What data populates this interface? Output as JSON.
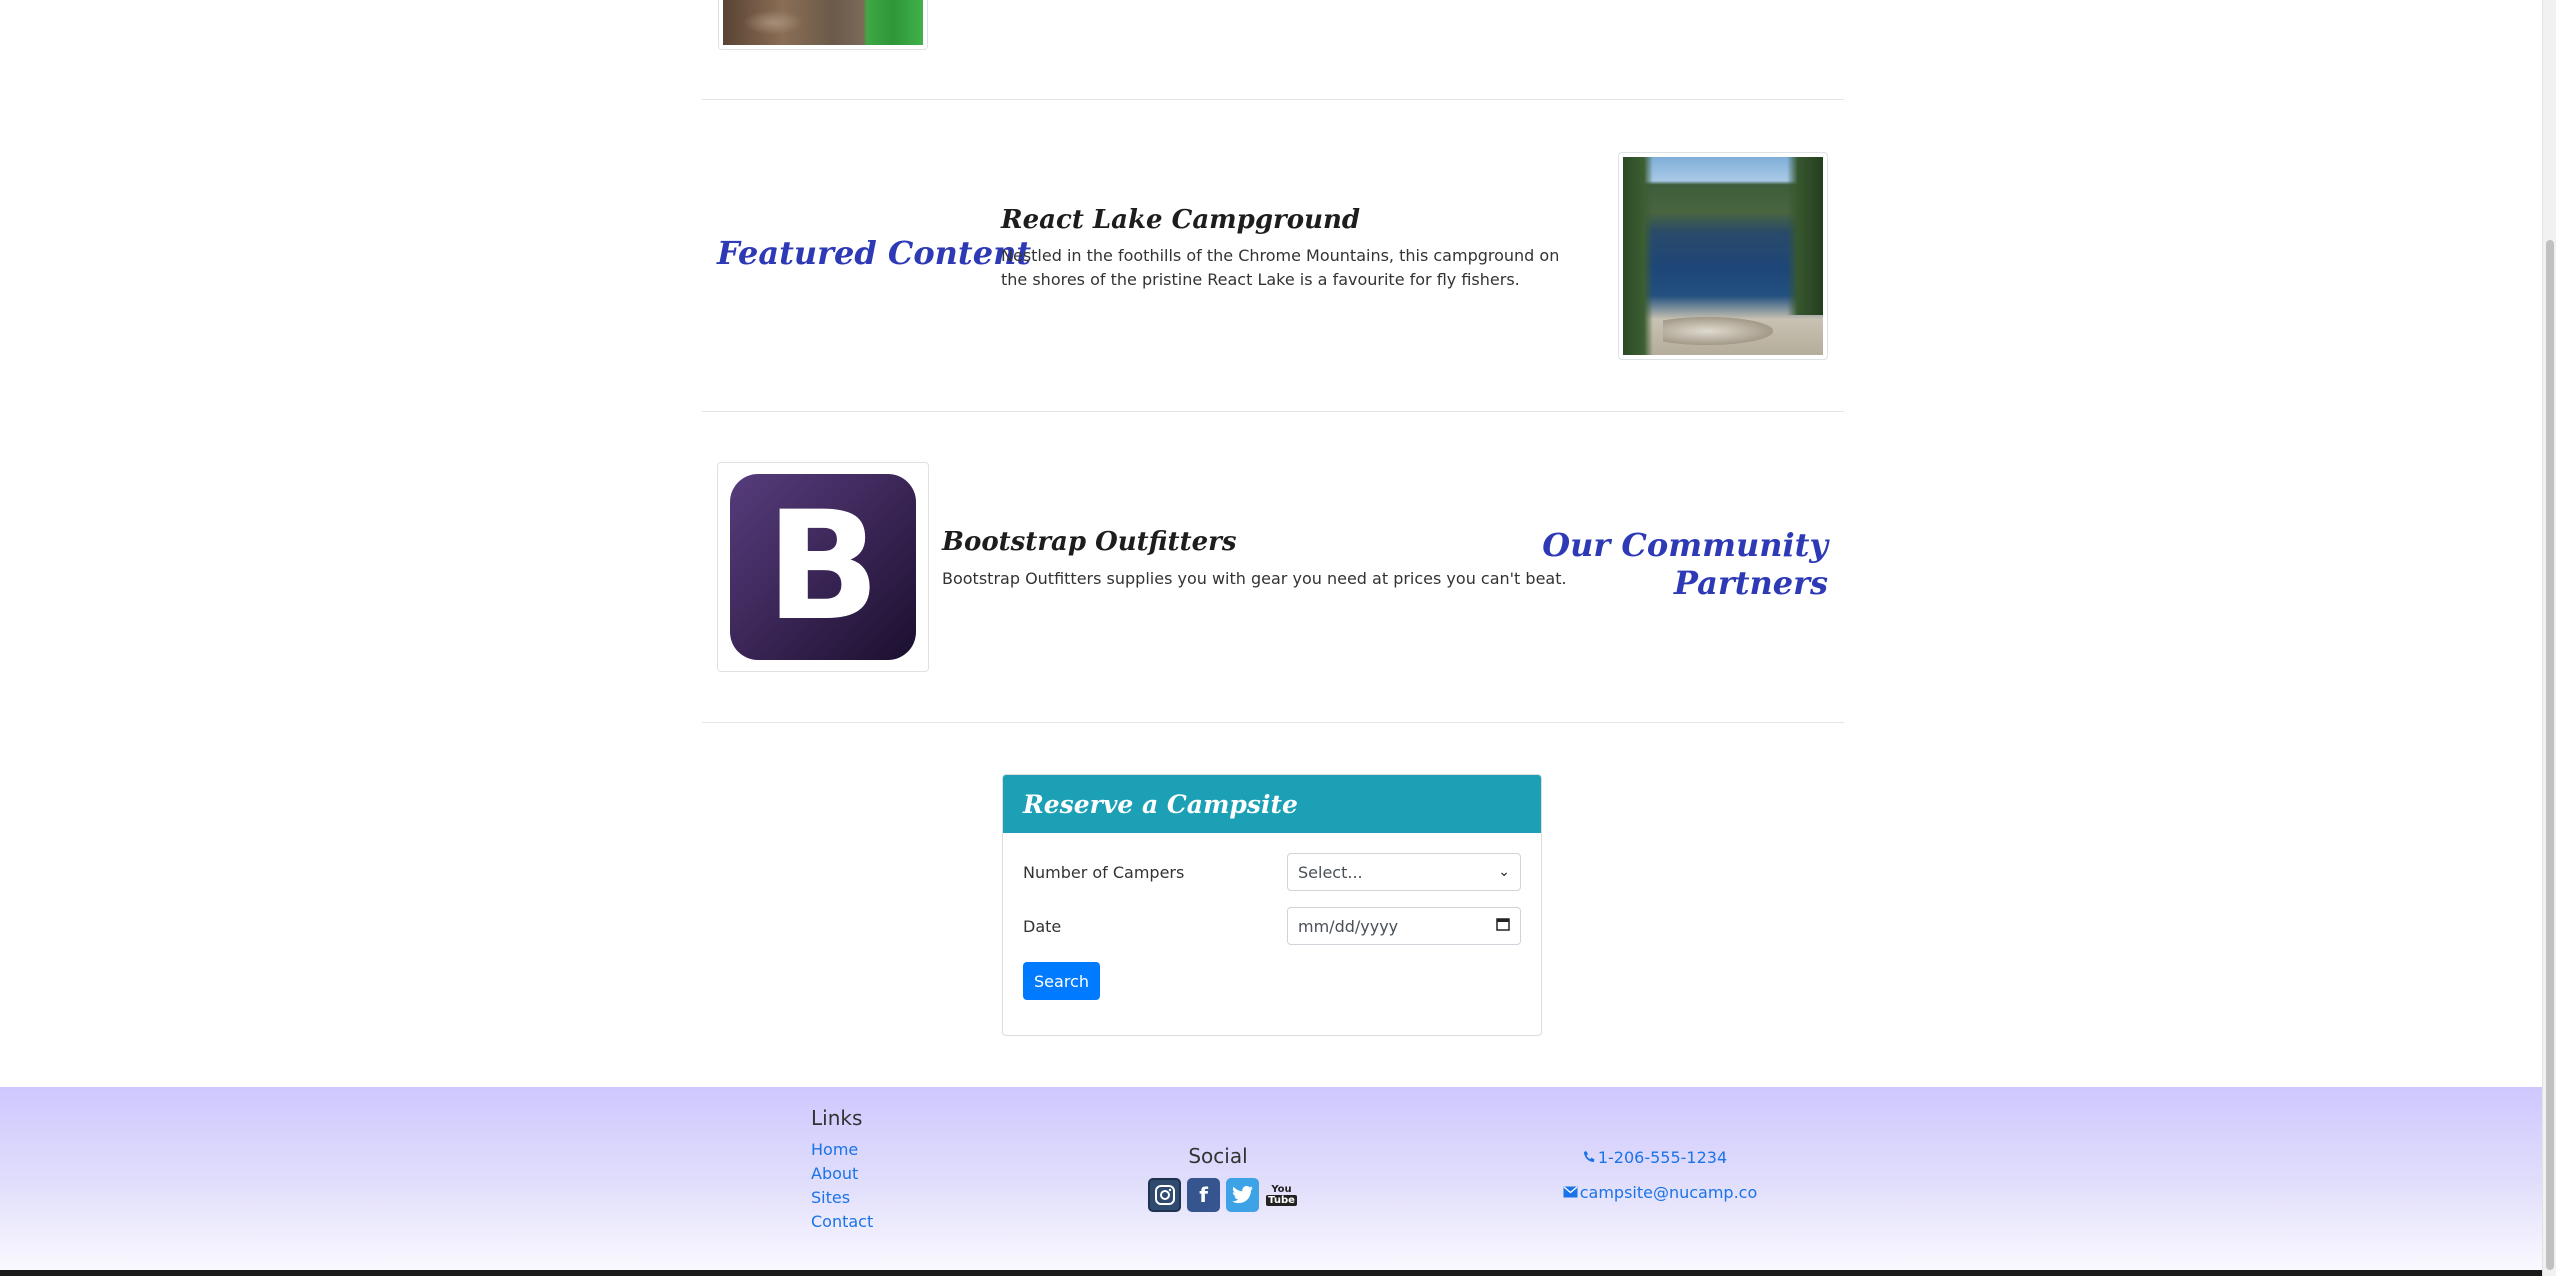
{
  "featured": {
    "title": "Featured Content",
    "heading": "React Lake Campground",
    "text": "Nestled in the foothills of the Chrome Mountains, this campground on the shores of the pristine React Lake is a favourite for fly fishers."
  },
  "partners": {
    "title_line1": "Our Community",
    "title_line2": "Partners",
    "heading": "Bootstrap Outfitters",
    "text": "Bootstrap Outfitters supplies you with gear you need at prices you can't beat.",
    "logo_letter": "B"
  },
  "reserve": {
    "title": "Reserve a Campsite",
    "campers_label": "Number of Campers",
    "campers_value": "Select...",
    "date_label": "Date",
    "date_placeholder": "mm/dd/yyyy",
    "search_label": "Search"
  },
  "footer": {
    "links_title": "Links",
    "links": [
      "Home",
      "About",
      "Sites",
      "Contact"
    ],
    "social_title": "Social",
    "phone": "1-206-555-1234",
    "email": "campsite@nucamp.co"
  },
  "colors": {
    "title_blue": "#2e39b6",
    "card_header": "#1ca0b6",
    "button": "#007bff",
    "link": "#1a73e8"
  }
}
